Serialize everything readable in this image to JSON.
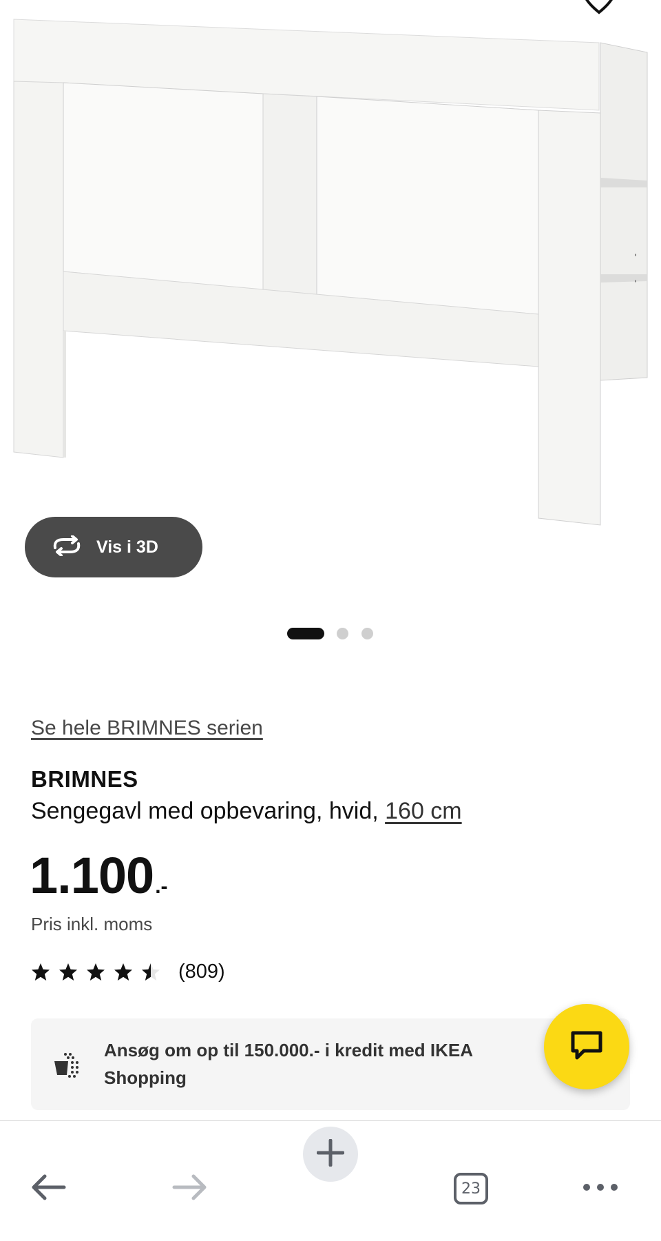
{
  "product_image": {
    "alt": "BRIMNES",
    "view_3d_label": "Vis i 3D",
    "carousel": {
      "count": 3,
      "active_index": 0
    }
  },
  "series_link": "Se hele BRIMNES serien",
  "product": {
    "name": "BRIMNES",
    "description": "Sengegavl med opbevaring, hvid, ",
    "size_link": "160 cm"
  },
  "price": {
    "main": "1.100",
    "suffix": ".-",
    "note": "Pris inkl. moms"
  },
  "rating": {
    "stars": 4.5,
    "max": 5,
    "review_count": "(809)"
  },
  "credit_banner": {
    "text": "Ansøg om op til 150.000.- i kredit med IKEA Shopping"
  },
  "toolbar": {
    "tab_count": "23"
  },
  "colors": {
    "chat_button": "#fbd914",
    "view_3d_button": "#4a4a4a",
    "banner_bg": "#f5f5f5"
  },
  "icons": [
    "heart-icon",
    "rotate-3d-icon",
    "credit-icon",
    "chat-icon",
    "back-arrow-icon",
    "forward-arrow-icon",
    "plus-icon",
    "tabs-icon",
    "more-icon"
  ]
}
